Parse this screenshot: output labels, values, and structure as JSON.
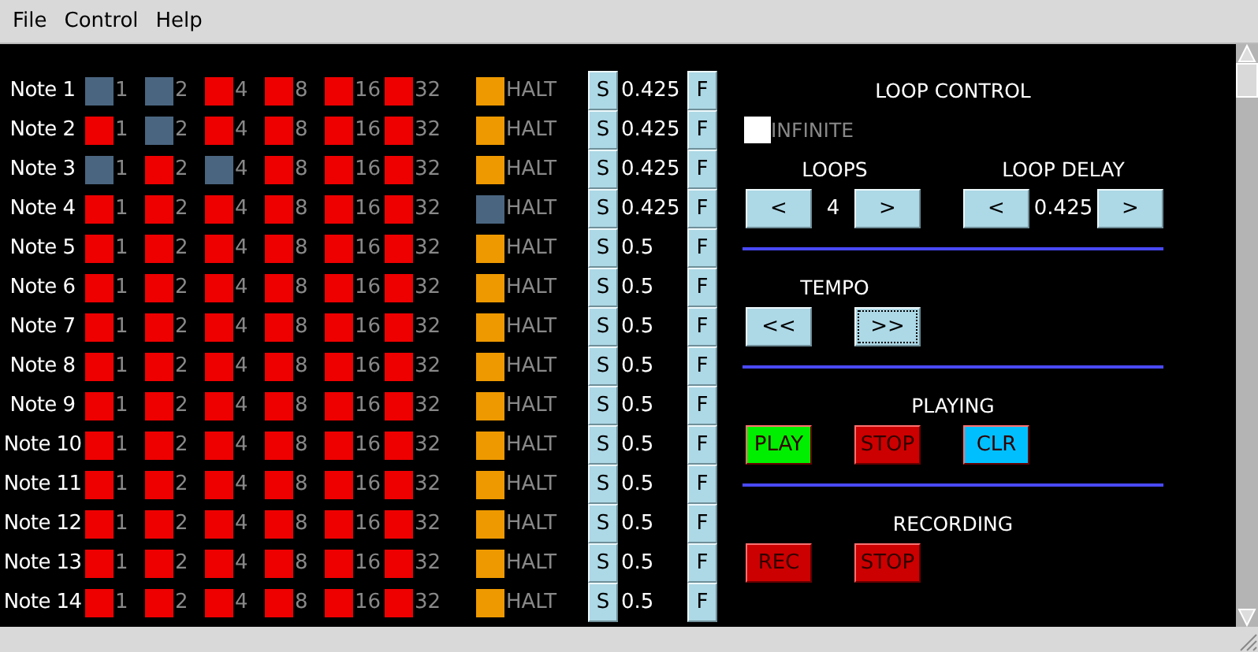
{
  "menu": [
    "File",
    "Control",
    "Help"
  ],
  "notes": [
    {
      "label": "Note 1",
      "bits": [
        {
          "label": "1",
          "on": true
        },
        {
          "label": "2",
          "on": true
        },
        {
          "label": "4",
          "on": false
        },
        {
          "label": "8",
          "on": false
        },
        {
          "label": "16",
          "on": false
        },
        {
          "label": "32",
          "on": false
        }
      ],
      "halt": {
        "label": "HALT",
        "on": false
      },
      "s": "S",
      "value": "0.425",
      "f": "F"
    },
    {
      "label": "Note 2",
      "bits": [
        {
          "label": "1",
          "on": false
        },
        {
          "label": "2",
          "on": true
        },
        {
          "label": "4",
          "on": false
        },
        {
          "label": "8",
          "on": false
        },
        {
          "label": "16",
          "on": false
        },
        {
          "label": "32",
          "on": false
        }
      ],
      "halt": {
        "label": "HALT",
        "on": false
      },
      "s": "S",
      "value": "0.425",
      "f": "F"
    },
    {
      "label": "Note 3",
      "bits": [
        {
          "label": "1",
          "on": true
        },
        {
          "label": "2",
          "on": false
        },
        {
          "label": "4",
          "on": true
        },
        {
          "label": "8",
          "on": false
        },
        {
          "label": "16",
          "on": false
        },
        {
          "label": "32",
          "on": false
        }
      ],
      "halt": {
        "label": "HALT",
        "on": false
      },
      "s": "S",
      "value": "0.425",
      "f": "F"
    },
    {
      "label": "Note 4",
      "bits": [
        {
          "label": "1",
          "on": false
        },
        {
          "label": "2",
          "on": false
        },
        {
          "label": "4",
          "on": false
        },
        {
          "label": "8",
          "on": false
        },
        {
          "label": "16",
          "on": false
        },
        {
          "label": "32",
          "on": false
        }
      ],
      "halt": {
        "label": "HALT",
        "on": true
      },
      "s": "S",
      "value": "0.425",
      "f": "F"
    },
    {
      "label": "Note 5",
      "bits": [
        {
          "label": "1",
          "on": false
        },
        {
          "label": "2",
          "on": false
        },
        {
          "label": "4",
          "on": false
        },
        {
          "label": "8",
          "on": false
        },
        {
          "label": "16",
          "on": false
        },
        {
          "label": "32",
          "on": false
        }
      ],
      "halt": {
        "label": "HALT",
        "on": false
      },
      "s": "S",
      "value": "0.5",
      "f": "F"
    },
    {
      "label": "Note 6",
      "bits": [
        {
          "label": "1",
          "on": false
        },
        {
          "label": "2",
          "on": false
        },
        {
          "label": "4",
          "on": false
        },
        {
          "label": "8",
          "on": false
        },
        {
          "label": "16",
          "on": false
        },
        {
          "label": "32",
          "on": false
        }
      ],
      "halt": {
        "label": "HALT",
        "on": false
      },
      "s": "S",
      "value": "0.5",
      "f": "F"
    },
    {
      "label": "Note 7",
      "bits": [
        {
          "label": "1",
          "on": false
        },
        {
          "label": "2",
          "on": false
        },
        {
          "label": "4",
          "on": false
        },
        {
          "label": "8",
          "on": false
        },
        {
          "label": "16",
          "on": false
        },
        {
          "label": "32",
          "on": false
        }
      ],
      "halt": {
        "label": "HALT",
        "on": false
      },
      "s": "S",
      "value": "0.5",
      "f": "F"
    },
    {
      "label": "Note 8",
      "bits": [
        {
          "label": "1",
          "on": false
        },
        {
          "label": "2",
          "on": false
        },
        {
          "label": "4",
          "on": false
        },
        {
          "label": "8",
          "on": false
        },
        {
          "label": "16",
          "on": false
        },
        {
          "label": "32",
          "on": false
        }
      ],
      "halt": {
        "label": "HALT",
        "on": false
      },
      "s": "S",
      "value": "0.5",
      "f": "F"
    },
    {
      "label": "Note 9",
      "bits": [
        {
          "label": "1",
          "on": false
        },
        {
          "label": "2",
          "on": false
        },
        {
          "label": "4",
          "on": false
        },
        {
          "label": "8",
          "on": false
        },
        {
          "label": "16",
          "on": false
        },
        {
          "label": "32",
          "on": false
        }
      ],
      "halt": {
        "label": "HALT",
        "on": false
      },
      "s": "S",
      "value": "0.5",
      "f": "F"
    },
    {
      "label": "Note 10",
      "bits": [
        {
          "label": "1",
          "on": false
        },
        {
          "label": "2",
          "on": false
        },
        {
          "label": "4",
          "on": false
        },
        {
          "label": "8",
          "on": false
        },
        {
          "label": "16",
          "on": false
        },
        {
          "label": "32",
          "on": false
        }
      ],
      "halt": {
        "label": "HALT",
        "on": false
      },
      "s": "S",
      "value": "0.5",
      "f": "F"
    },
    {
      "label": "Note 11",
      "bits": [
        {
          "label": "1",
          "on": false
        },
        {
          "label": "2",
          "on": false
        },
        {
          "label": "4",
          "on": false
        },
        {
          "label": "8",
          "on": false
        },
        {
          "label": "16",
          "on": false
        },
        {
          "label": "32",
          "on": false
        }
      ],
      "halt": {
        "label": "HALT",
        "on": false
      },
      "s": "S",
      "value": "0.5",
      "f": "F"
    },
    {
      "label": "Note 12",
      "bits": [
        {
          "label": "1",
          "on": false
        },
        {
          "label": "2",
          "on": false
        },
        {
          "label": "4",
          "on": false
        },
        {
          "label": "8",
          "on": false
        },
        {
          "label": "16",
          "on": false
        },
        {
          "label": "32",
          "on": false
        }
      ],
      "halt": {
        "label": "HALT",
        "on": false
      },
      "s": "S",
      "value": "0.5",
      "f": "F"
    },
    {
      "label": "Note 13",
      "bits": [
        {
          "label": "1",
          "on": false
        },
        {
          "label": "2",
          "on": false
        },
        {
          "label": "4",
          "on": false
        },
        {
          "label": "8",
          "on": false
        },
        {
          "label": "16",
          "on": false
        },
        {
          "label": "32",
          "on": false
        }
      ],
      "halt": {
        "label": "HALT",
        "on": false
      },
      "s": "S",
      "value": "0.5",
      "f": "F"
    },
    {
      "label": "Note 14",
      "bits": [
        {
          "label": "1",
          "on": false
        },
        {
          "label": "2",
          "on": false
        },
        {
          "label": "4",
          "on": false
        },
        {
          "label": "8",
          "on": false
        },
        {
          "label": "16",
          "on": false
        },
        {
          "label": "32",
          "on": false
        }
      ],
      "halt": {
        "label": "HALT",
        "on": false
      },
      "s": "S",
      "value": "0.5",
      "f": "F"
    }
  ],
  "loop_control": {
    "title": "LOOP CONTROL",
    "infinite": {
      "label": "INFINITE",
      "checked": false
    },
    "loops": {
      "label": "LOOPS",
      "decrease": "<",
      "value": "4",
      "increase": ">"
    },
    "loop_delay": {
      "label": "LOOP DELAY",
      "decrease": "<",
      "value": "0.425",
      "increase": ">"
    }
  },
  "tempo": {
    "title": "TEMPO",
    "buttons": [
      {
        "label": "<<",
        "focused": false
      },
      {
        "label": ">>",
        "focused": true
      }
    ]
  },
  "playing": {
    "title": "PLAYING",
    "buttons": [
      {
        "label": "PLAY",
        "color": "#00ee00"
      },
      {
        "label": "STOP",
        "color": "#cc0000"
      },
      {
        "label": "CLR",
        "color": "#00bfff"
      }
    ]
  },
  "recording": {
    "title": "RECORDING",
    "buttons": [
      {
        "label": "REC",
        "color": "#cc0000"
      },
      {
        "label": "STOP",
        "color": "#cc0000"
      }
    ]
  }
}
